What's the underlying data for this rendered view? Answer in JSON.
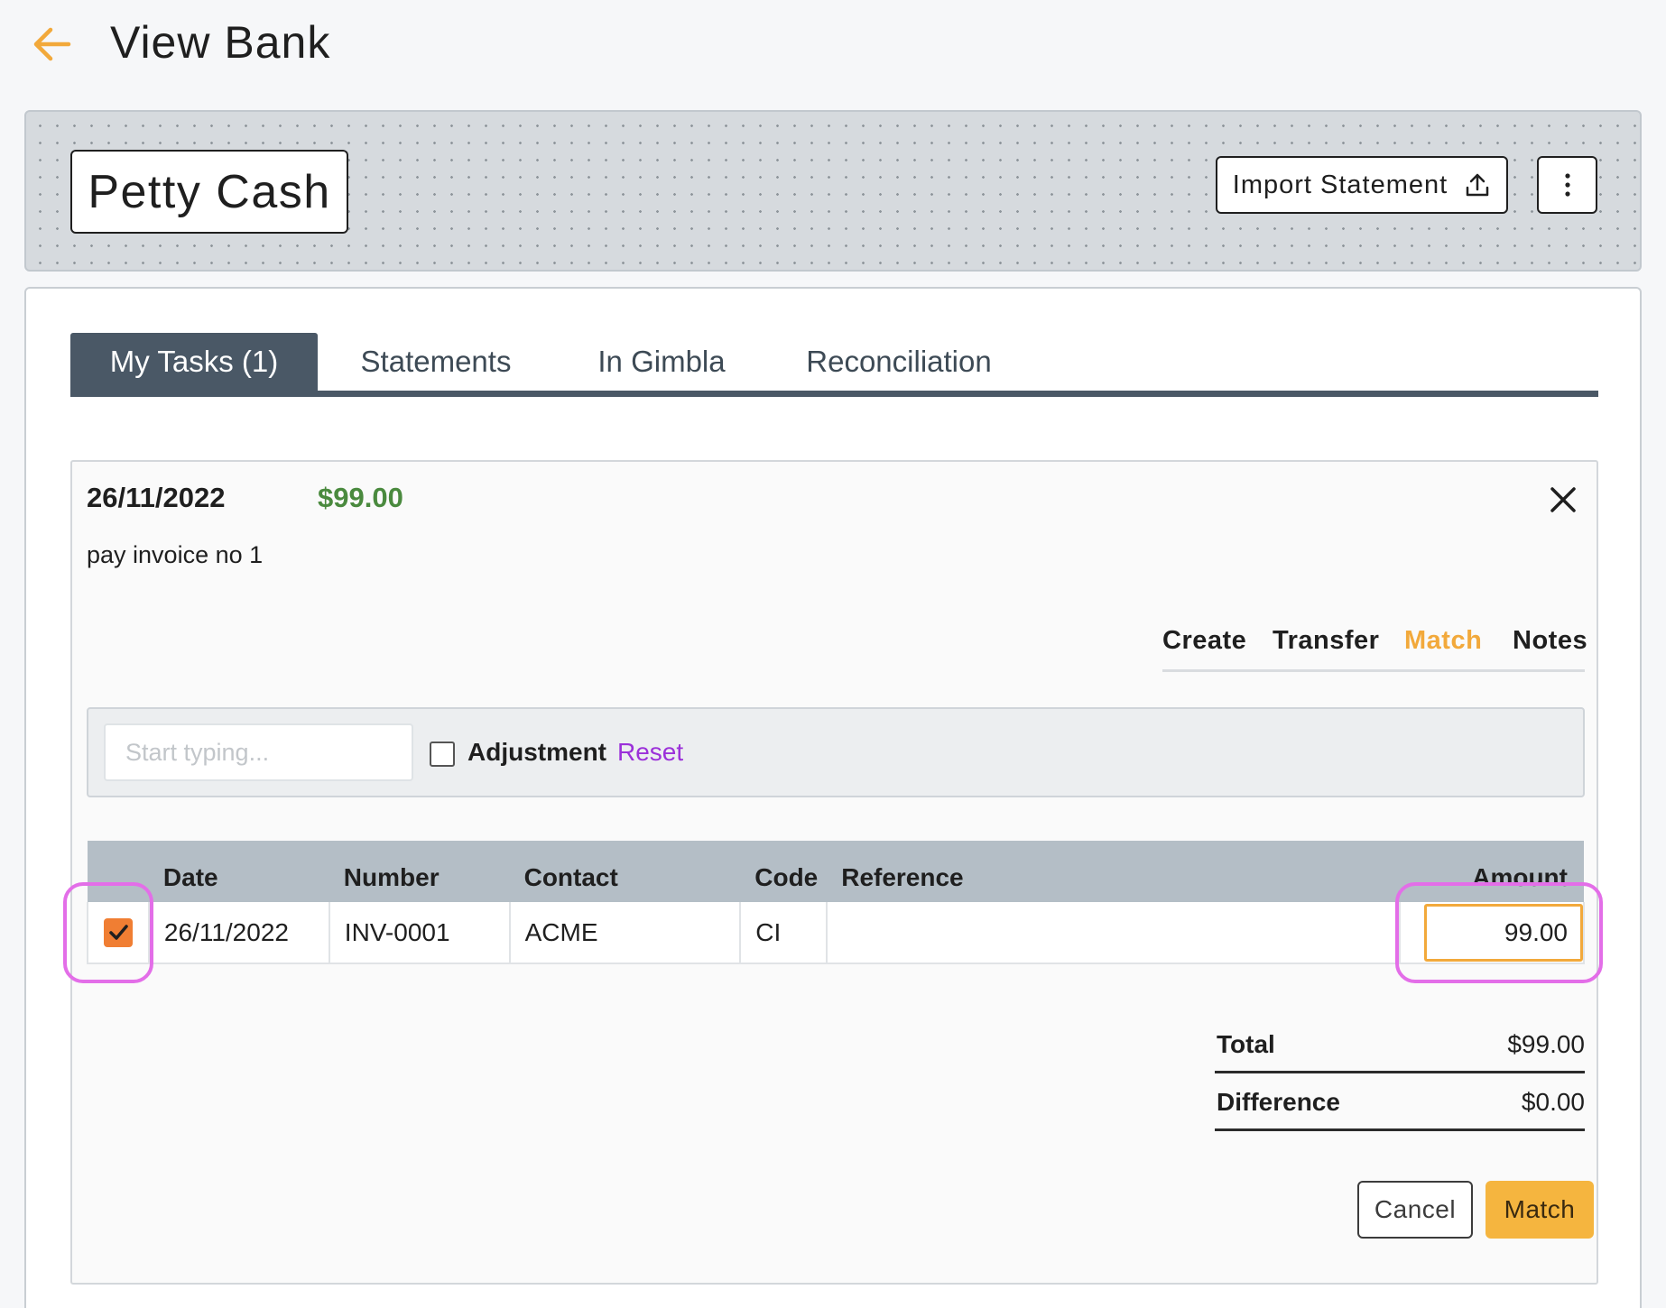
{
  "header": {
    "title": "View Bank",
    "back_icon": "arrow-left-icon",
    "accent_color": "#f2a93b"
  },
  "account": {
    "name": "Petty Cash"
  },
  "toolbar": {
    "import_label": "Import Statement",
    "import_icon": "upload-icon",
    "more_icon": "vertical-dots-icon"
  },
  "tabs": [
    {
      "label": "My Tasks (1)",
      "active": true
    },
    {
      "label": "Statements",
      "active": false
    },
    {
      "label": "In Gimbla",
      "active": false
    },
    {
      "label": "Reconciliation",
      "active": false
    }
  ],
  "task": {
    "date": "26/11/2022",
    "amount": "$99.00",
    "amount_color": "#4a8a3e",
    "description": "pay invoice no 1"
  },
  "action_tabs": [
    {
      "label": "Create",
      "active": false
    },
    {
      "label": "Transfer",
      "active": false
    },
    {
      "label": "Match",
      "active": true
    },
    {
      "label": "Notes",
      "active": false
    }
  ],
  "filter": {
    "search_placeholder": "Start typing...",
    "adjustment_label": "Adjustment",
    "adjustment_checked": false,
    "reset_label": "Reset"
  },
  "table": {
    "columns": [
      "",
      "Date",
      "Number",
      "Contact",
      "Code",
      "Reference",
      "Amount"
    ],
    "rows": [
      {
        "checked": true,
        "date": "26/11/2022",
        "number": "INV-0001",
        "contact": "ACME",
        "code": "CI",
        "reference": "",
        "amount": "99.00"
      }
    ]
  },
  "totals": {
    "total_label": "Total",
    "total_value": "$99.00",
    "difference_label": "Difference",
    "difference_value": "$0.00"
  },
  "buttons": {
    "cancel_label": "Cancel",
    "match_label": "Match"
  }
}
